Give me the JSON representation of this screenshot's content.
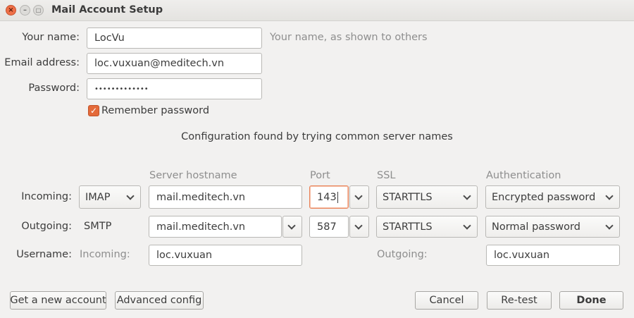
{
  "window": {
    "title": "Mail Account Setup",
    "close_glyph": "×",
    "minimize_glyph": "–",
    "maximize_glyph": "□"
  },
  "form": {
    "name_label": "Your name:",
    "name_value": "LocVu",
    "name_hint": "Your name, as shown to others",
    "email_label": "Email address:",
    "email_value": "loc.vuxuan@meditech.vn",
    "password_label": "Password:",
    "password_value": "•••••••••••••",
    "remember_label": "Remember password",
    "remember_checked": true,
    "status_message": "Configuration found by trying common server names"
  },
  "server": {
    "headers": {
      "hostname": "Server hostname",
      "port": "Port",
      "ssl": "SSL",
      "auth": "Authentication"
    },
    "incoming": {
      "label": "Incoming:",
      "protocol": "IMAP",
      "hostname": "mail.meditech.vn",
      "port": "143",
      "ssl": "STARTTLS",
      "auth": "Encrypted password"
    },
    "outgoing": {
      "label": "Outgoing:",
      "protocol": "SMTP",
      "hostname": "mail.meditech.vn",
      "port": "587",
      "ssl": "STARTTLS",
      "auth": "Normal password"
    },
    "username": {
      "label": "Username:",
      "incoming_label": "Incoming:",
      "incoming_value": "loc.vuxuan",
      "outgoing_label": "Outgoing:",
      "outgoing_value": "loc.vuxuan"
    }
  },
  "buttons": {
    "new_account": "Get a new account",
    "advanced_config": "Advanced config",
    "cancel": "Cancel",
    "retest": "Re-test",
    "done": "Done"
  },
  "colors": {
    "accent": "#e46a3a",
    "close_button": "#ef7048",
    "hint_text": "#8e8e8e",
    "background": "#f2f1f0"
  }
}
